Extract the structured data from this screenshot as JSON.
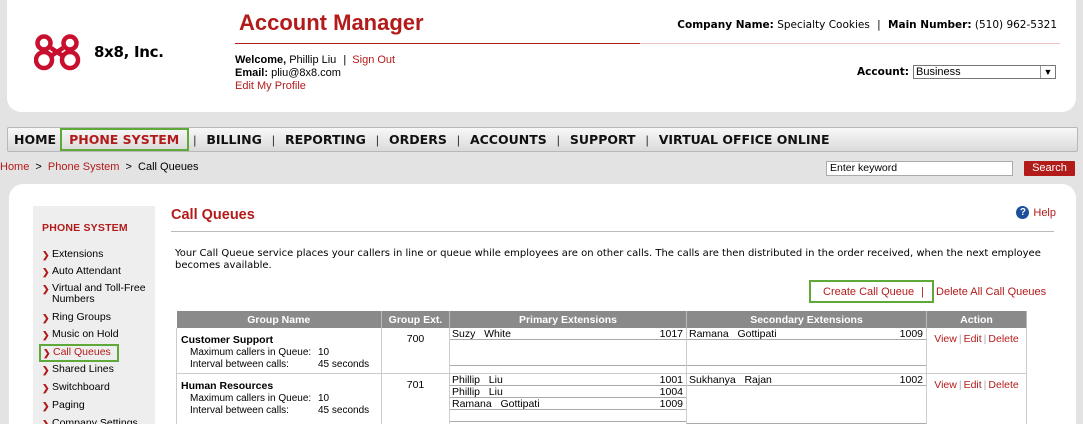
{
  "brand": {
    "company_text": "8x8, Inc.",
    "accent": "#b31b1b",
    "highlight": "#5fa83a"
  },
  "header": {
    "app_title": "Account Manager",
    "company_label": "Company Name:",
    "company_value": "Specialty Cookies",
    "separator": "|",
    "main_number_label": "Main Number:",
    "main_number_value": "(510) 962-5321",
    "welcome_label": "Welcome,",
    "user_name": "Phillip Liu",
    "sign_out": "Sign Out",
    "email_label": "Email:",
    "email_value": "pliu@8x8.com",
    "edit_profile": "Edit My Profile",
    "account_label": "Account:",
    "account_value": "Business"
  },
  "nav": {
    "items": [
      "HOME",
      "PHONE SYSTEM",
      "BILLING",
      "REPORTING",
      "ORDERS",
      "ACCOUNTS",
      "SUPPORT",
      "VIRTUAL OFFICE ONLINE"
    ],
    "active": "PHONE SYSTEM",
    "separator": "|"
  },
  "breadcrumb": {
    "home": "Home",
    "section": "Phone System",
    "current": "Call Queues",
    "sep": ">"
  },
  "search": {
    "placeholder": "Enter keyword",
    "button": "Search"
  },
  "sidebar": {
    "title": "PHONE SYSTEM",
    "items": [
      "Extensions",
      "Auto Attendant",
      "Virtual and Toll-Free Numbers",
      "Ring Groups",
      "Music on Hold",
      "Call Queues",
      "Shared Lines",
      "Switchboard",
      "Paging",
      "Company Settings"
    ],
    "active": "Call Queues"
  },
  "main": {
    "title": "Call Queues",
    "help": "Help",
    "intro": "Your Call Queue service places your callers in line or queue while employees are on other calls. The calls are then distributed in the order received, when the next employee becomes available.",
    "create_link": "Create Call Queue",
    "pipe": "|",
    "delete_all_link": "Delete All Call Queues"
  },
  "table": {
    "headers": [
      "Group Name",
      "Group Ext.",
      "Primary Extensions",
      "Secondary Extensions",
      "Action"
    ],
    "rows": [
      {
        "name": "Customer Support",
        "max_label": "Maximum callers in Queue:",
        "max_value": "10",
        "interval_label": "Interval between calls:",
        "interval_value": "45 seconds",
        "ext": "700",
        "primary": [
          {
            "name": "Suzy   White",
            "ext": "1017"
          }
        ],
        "secondary": [
          {
            "name": "Ramana   Gottipati",
            "ext": "1009"
          }
        ],
        "actions": [
          "View",
          "Edit",
          "Delete"
        ]
      },
      {
        "name": "Human Resources",
        "max_label": "Maximum callers in Queue:",
        "max_value": "10",
        "interval_label": "Interval between calls:",
        "interval_value": "45 seconds",
        "ext": "701",
        "primary": [
          {
            "name": "Phillip   Liu",
            "ext": "1001"
          },
          {
            "name": "Phillip   Liu",
            "ext": "1004"
          },
          {
            "name": "Ramana   Gottipati",
            "ext": "1009"
          }
        ],
        "secondary": [
          {
            "name": "Sukhanya   Rajan",
            "ext": "1002"
          }
        ],
        "actions": [
          "View",
          "Edit",
          "Delete"
        ]
      }
    ]
  }
}
